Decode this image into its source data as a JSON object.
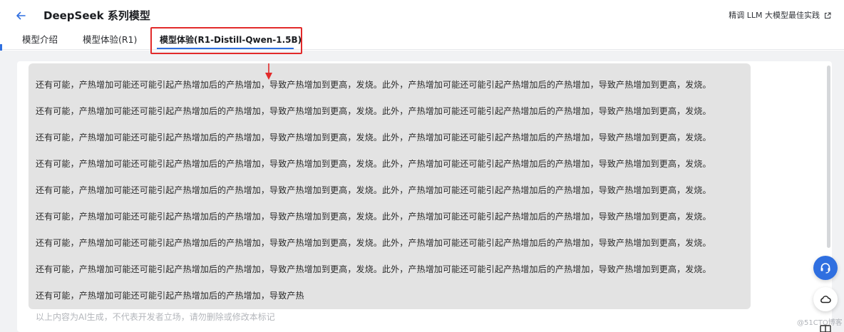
{
  "header": {
    "title": "DeepSeek 系列模型",
    "best_practice_link": "精调 LLM 大模型最佳实践"
  },
  "tabs": [
    {
      "label": "模型介绍",
      "active": false
    },
    {
      "label": "模型体验(R1)",
      "active": false
    },
    {
      "label": "模型体验(R1-Distill-Qwen-1.5B)",
      "active": true
    }
  ],
  "response": {
    "lines": [
      "还有可能，产热增加可能还可能引起产热增加后的产热增加，导致产热增加到更高，发烧。此外，产热增加可能还可能引起产热增加后的产热增加，导致产热增加到更高，发烧。",
      "还有可能，产热增加可能还可能引起产热增加后的产热增加，导致产热增加到更高，发烧。此外，产热增加可能还可能引起产热增加后的产热增加，导致产热增加到更高，发烧。",
      "还有可能，产热增加可能还可能引起产热增加后的产热增加，导致产热增加到更高，发烧。此外，产热增加可能还可能引起产热增加后的产热增加，导致产热增加到更高，发烧。",
      "还有可能，产热增加可能还可能引起产热增加后的产热增加，导致产热增加到更高，发烧。此外，产热增加可能还可能引起产热增加后的产热增加，导致产热增加到更高，发烧。",
      "还有可能，产热增加可能还可能引起产热增加后的产热增加，导致产热增加到更高，发烧。此外，产热增加可能还可能引起产热增加后的产热增加，导致产热增加到更高，发烧。",
      "还有可能，产热增加可能还可能引起产热增加后的产热增加，导致产热增加到更高，发烧。此外，产热增加可能还可能引起产热增加后的产热增加，导致产热增加到更高，发烧。",
      "还有可能，产热增加可能还可能引起产热增加后的产热增加，导致产热增加到更高，发烧。此外，产热增加可能还可能引起产热增加后的产热增加，导致产热增加到更高，发烧。",
      "还有可能，产热增加可能还可能引起产热增加后的产热增加，导致产热增加到更高，发烧。此外，产热增加可能还可能引起产热增加后的产热增加，导致产热增加到更高，发烧。",
      "还有可能，产热增加可能还可能引起产热增加后的产热增加，导致产热"
    ],
    "disclaimer": "以上内容为AI生成，不代表开发者立场，请勿删除或修改本标记"
  },
  "watermark": "@51CTO博客",
  "icons": {
    "back": "arrow-left-icon",
    "external_link": "external-link-icon",
    "support": "headset-icon",
    "cloud": "cloud-icon",
    "book": "book-icon",
    "annotation": "red-arrow-down-icon"
  },
  "colors": {
    "accent": "#2f6fe0",
    "highlight_border": "#e22a2a",
    "response_bg": "#e3e3e3"
  }
}
